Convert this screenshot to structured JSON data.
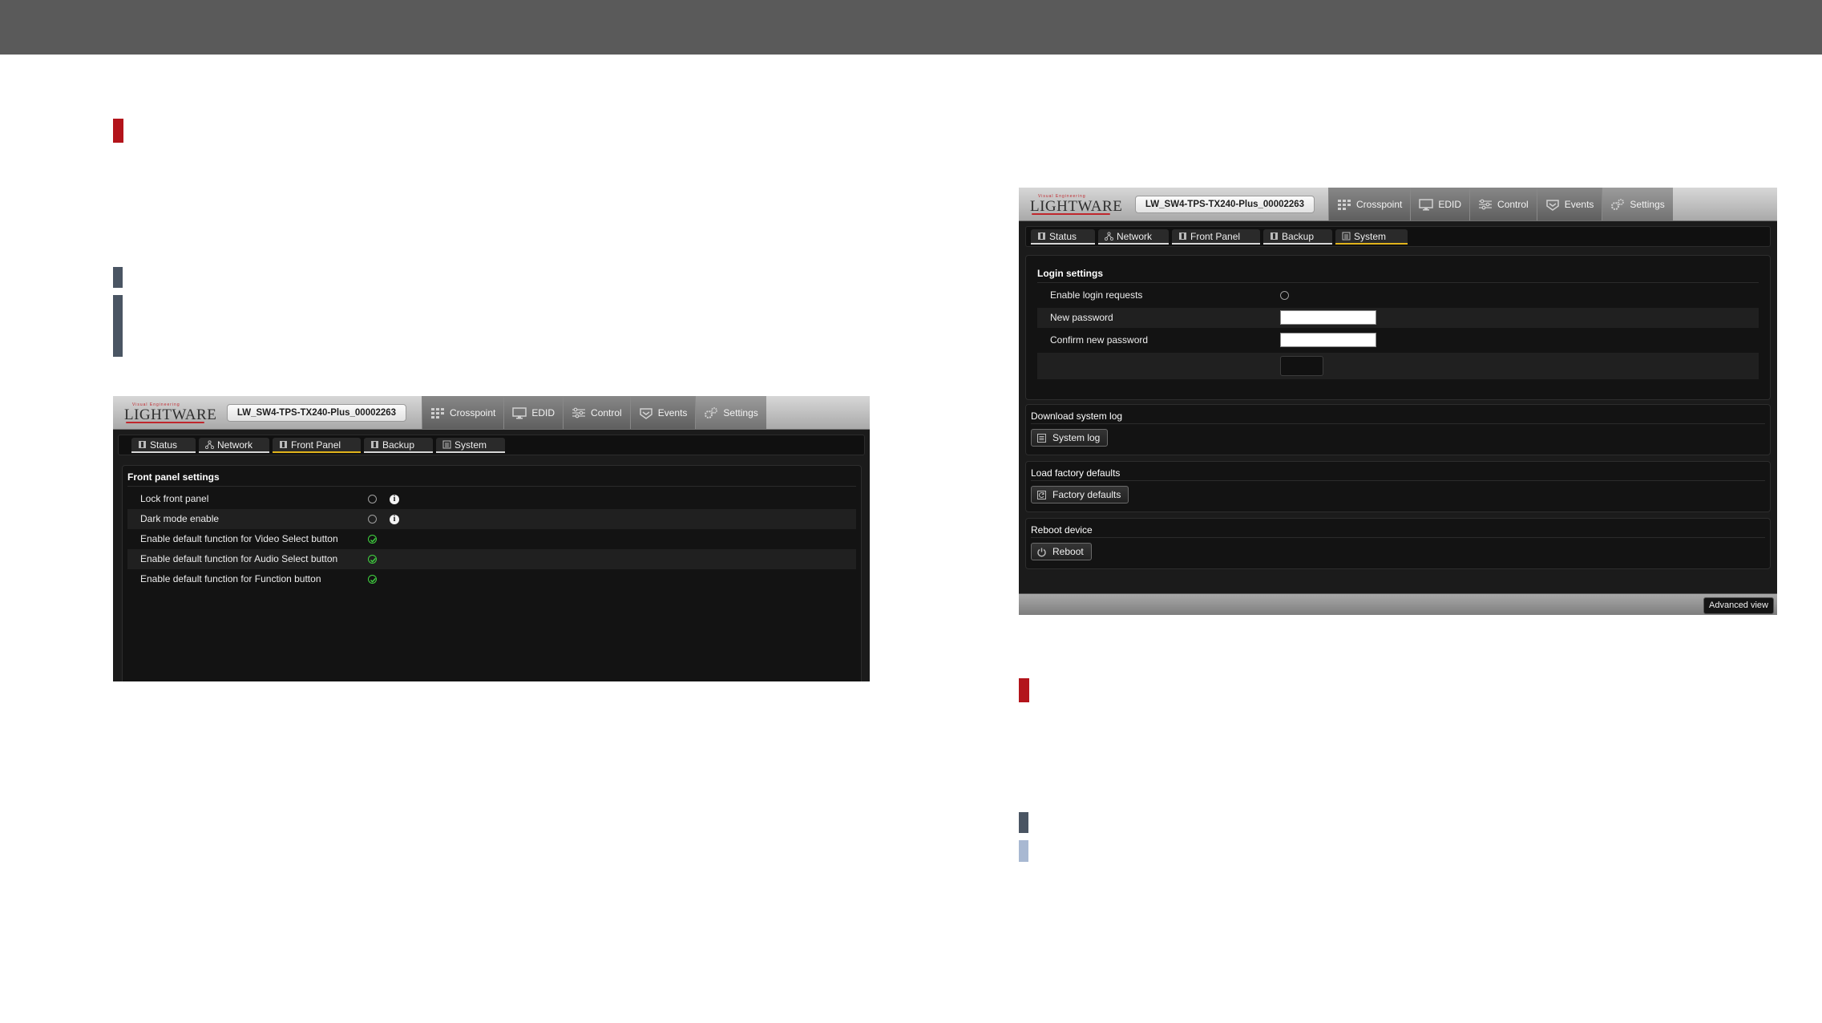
{
  "colors": {
    "topbar": "#5a5a5a",
    "marker_red": "#b3141b",
    "marker_slate": "#4a5563",
    "marker_lightblue": "#a8b8d2",
    "active_tab_underline": "#e0b31b",
    "check_on": "#3fd23f"
  },
  "brand": {
    "tagline": "Visual Engineering",
    "name": "LIGHTWARE"
  },
  "device_name": "LW_SW4-TPS-TX240-Plus_00002263",
  "main_nav": [
    "Crosspoint",
    "EDID",
    "Control",
    "Events",
    "Settings"
  ],
  "main_nav_icons": [
    "grid-icon",
    "monitor-icon",
    "sliders-icon",
    "events-icon",
    "gears-icon"
  ],
  "settings_tabs": [
    "Status",
    "Network",
    "Front Panel",
    "Backup",
    "System"
  ],
  "front_panel_screen": {
    "active_tab": "Front Panel",
    "section_title": "Front panel settings",
    "rows": [
      {
        "label": "Lock front panel",
        "checked": false,
        "info": true
      },
      {
        "label": "Dark mode enable",
        "checked": false,
        "info": true
      },
      {
        "label": "Enable default function for Video Select button",
        "checked": true,
        "info": false
      },
      {
        "label": "Enable default function for Audio Select button",
        "checked": true,
        "info": false
      },
      {
        "label": "Enable default function for Function button",
        "checked": true,
        "info": false
      }
    ]
  },
  "system_screen": {
    "active_tab": "System",
    "login_title": "Login settings",
    "login_rows": [
      {
        "label": "Enable login requests",
        "control": "checkbox",
        "checked": false
      },
      {
        "label": "New password",
        "control": "password",
        "value": ""
      },
      {
        "label": "Confirm new password",
        "control": "password",
        "value": ""
      }
    ],
    "download_log": {
      "title": "Download system log",
      "button": "System log"
    },
    "factory": {
      "title": "Load factory defaults",
      "button": "Factory defaults"
    },
    "reboot": {
      "title": "Reboot device",
      "button": "Reboot"
    },
    "advanced_view": "Advanced view"
  }
}
